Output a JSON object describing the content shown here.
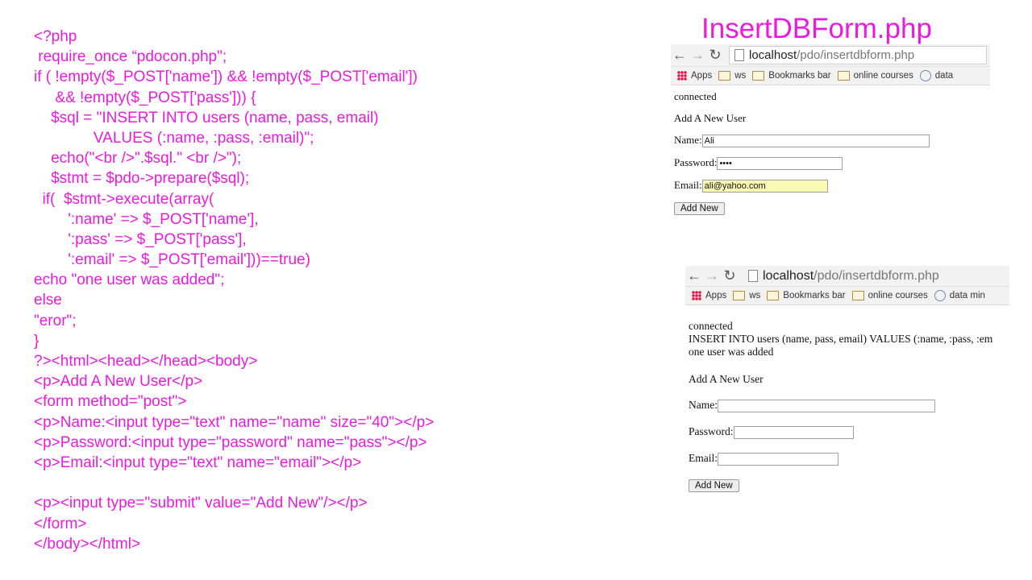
{
  "title": "InsertDBForm.php",
  "code_lines": [
    "<?php",
    " require_once “pdocon.php\";",
    "if ( !empty($_POST['name']) && !empty($_POST['email'])",
    "     && !empty($_POST['pass'])) {",
    "    $sql = \"INSERT INTO users (name, pass, email)",
    "              VALUES (:name, :pass, :email)\";",
    "    echo(\"<br />\".$sql.\" <br />\");",
    "    $stmt = $pdo->prepare($sql);",
    "  if(  $stmt->execute(array(",
    "        ':name' => $_POST['name'],",
    "        ':pass' => $_POST['pass'],",
    "        ':email' => $_POST['email']))==true)",
    "echo \"one user was added\";",
    "else",
    "\"eror\";",
    "}",
    "?><html><head></head><body>",
    "<p>Add A New User</p>",
    "<form method=\"post\">",
    "<p>Name:<input type=\"text\" name=\"name\" size=\"40\"></p>",
    "<p>Password:<input type=\"password\" name=\"pass\"></p>",
    "<p>Email:<input type=\"text\" name=\"email\"></p>",
    "",
    "<p><input type=\"submit\" value=\"Add New\"/></p>",
    "</form>",
    "</body></html>"
  ],
  "browser1": {
    "url_host": "localhost",
    "url_path": "/pdo/insertdbform.php",
    "bookmarks": [
      "Apps",
      "ws",
      "Bookmarks bar",
      "online courses",
      "data"
    ],
    "connected": "connected",
    "heading": "Add A New User",
    "name_label": "Name:",
    "name_value": "Ali",
    "password_label": "Password:",
    "password_value": "••••",
    "email_label": "Email:",
    "email_value": "ali@yahoo.com",
    "submit_label": "Add New"
  },
  "browser2": {
    "url_host": "localhost",
    "url_path": "/pdo/insertdbform.php",
    "bookmarks": [
      "Apps",
      "ws",
      "Bookmarks bar",
      "online courses",
      "data min"
    ],
    "connected": "connected",
    "sql_echo": "INSERT INTO users (name, pass, email) VALUES (:name, :pass, :em",
    "result": "one user was added",
    "heading": "Add A New User",
    "name_label": "Name:",
    "password_label": "Password:",
    "email_label": "Email:",
    "submit_label": "Add New"
  },
  "colors": {
    "accent": "#ec1ae0",
    "autofill": "#fafab4"
  },
  "icons": [
    "back-arrow-icon",
    "forward-arrow-icon",
    "reload-icon",
    "page-icon",
    "apps-icon",
    "folder-icon",
    "globe-icon"
  ]
}
